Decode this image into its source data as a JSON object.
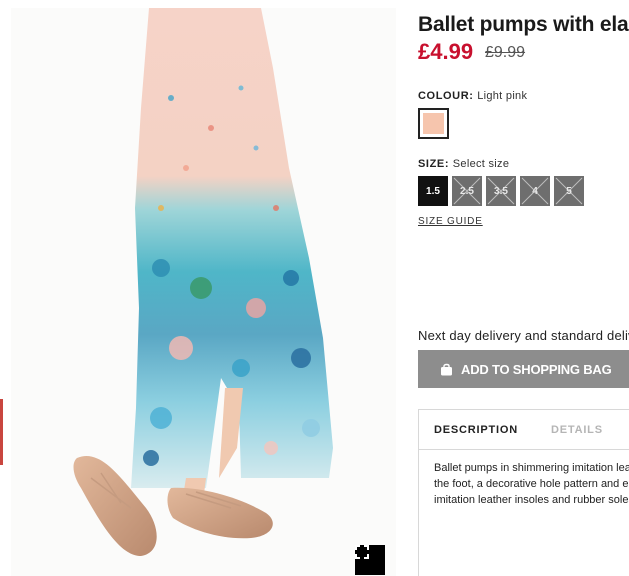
{
  "product": {
    "title": "Ballet pumps with elastic",
    "price_current": "£4.99",
    "price_original": "£9.99",
    "price_color": "#c8102e"
  },
  "colour": {
    "label": "COLOUR:",
    "value": "Light pink",
    "swatch_color": "#f6c5ad"
  },
  "size": {
    "label": "SIZE:",
    "placeholder": "Select size",
    "options": [
      {
        "label": "1.5",
        "available": true,
        "selected": true
      },
      {
        "label": "2.5",
        "available": false,
        "selected": false
      },
      {
        "label": "3.5",
        "available": false,
        "selected": false
      },
      {
        "label": "4",
        "available": false,
        "selected": false
      },
      {
        "label": "5",
        "available": false,
        "selected": false
      }
    ],
    "guide_label": "SIZE GUIDE"
  },
  "delivery_text": "Next day delivery and standard delivery",
  "add_to_bag": {
    "label": "ADD TO SHOPPING BAG",
    "icon": "shopping-bag-icon"
  },
  "tabs": [
    {
      "label": "DESCRIPTION",
      "active": true
    },
    {
      "label": "DETAILS",
      "active": false
    }
  ],
  "description_lines": [
    "Ballet pumps in shimmering imitation leather with",
    "the foot, a decorative hole pattern and elastic",
    "imitation leather insoles and rubber soles."
  ],
  "zoom_button": {
    "icon": "fullscreen-icon"
  },
  "image": {
    "subject": "product-photo"
  }
}
